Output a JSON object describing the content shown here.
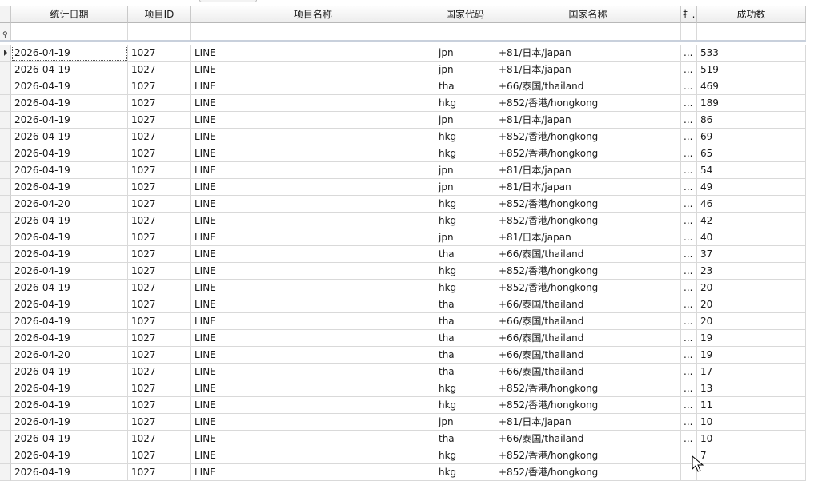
{
  "columns": [
    "统计日期",
    "项目ID",
    "项目名称",
    "国家代码",
    "国家名称",
    "扌.",
    "成功数"
  ],
  "rows": [
    [
      "2026-04-19",
      "1027",
      "LINE",
      "jpn",
      "+81/日本/japan",
      "...",
      "533"
    ],
    [
      "2026-04-19",
      "1027",
      "LINE",
      "jpn",
      "+81/日本/japan",
      "...",
      "519"
    ],
    [
      "2026-04-19",
      "1027",
      "LINE",
      "tha",
      "+66/泰国/thailand",
      "...",
      "469"
    ],
    [
      "2026-04-19",
      "1027",
      "LINE",
      "hkg",
      "+852/香港/hongkong",
      "...",
      "189"
    ],
    [
      "2026-04-19",
      "1027",
      "LINE",
      "jpn",
      "+81/日本/japan",
      "...",
      "86"
    ],
    [
      "2026-04-19",
      "1027",
      "LINE",
      "hkg",
      "+852/香港/hongkong",
      "...",
      "69"
    ],
    [
      "2026-04-19",
      "1027",
      "LINE",
      "hkg",
      "+852/香港/hongkong",
      "...",
      "65"
    ],
    [
      "2026-04-19",
      "1027",
      "LINE",
      "jpn",
      "+81/日本/japan",
      "...",
      "54"
    ],
    [
      "2026-04-19",
      "1027",
      "LINE",
      "jpn",
      "+81/日本/japan",
      "...",
      "49"
    ],
    [
      "2026-04-20",
      "1027",
      "LINE",
      "hkg",
      "+852/香港/hongkong",
      "...",
      "46"
    ],
    [
      "2026-04-19",
      "1027",
      "LINE",
      "hkg",
      "+852/香港/hongkong",
      "...",
      "42"
    ],
    [
      "2026-04-19",
      "1027",
      "LINE",
      "jpn",
      "+81/日本/japan",
      "...",
      "40"
    ],
    [
      "2026-04-19",
      "1027",
      "LINE",
      "tha",
      "+66/泰国/thailand",
      "...",
      "37"
    ],
    [
      "2026-04-19",
      "1027",
      "LINE",
      "hkg",
      "+852/香港/hongkong",
      "...",
      "23"
    ],
    [
      "2026-04-19",
      "1027",
      "LINE",
      "hkg",
      "+852/香港/hongkong",
      "...",
      "20"
    ],
    [
      "2026-04-19",
      "1027",
      "LINE",
      "tha",
      "+66/泰国/thailand",
      "...",
      "20"
    ],
    [
      "2026-04-19",
      "1027",
      "LINE",
      "tha",
      "+66/泰国/thailand",
      "...",
      "20"
    ],
    [
      "2026-04-19",
      "1027",
      "LINE",
      "tha",
      "+66/泰国/thailand",
      "...",
      "19"
    ],
    [
      "2026-04-20",
      "1027",
      "LINE",
      "tha",
      "+66/泰国/thailand",
      "...",
      "19"
    ],
    [
      "2026-04-19",
      "1027",
      "LINE",
      "tha",
      "+66/泰国/thailand",
      "...",
      "17"
    ],
    [
      "2026-04-19",
      "1027",
      "LINE",
      "hkg",
      "+852/香港/hongkong",
      "...",
      "13"
    ],
    [
      "2026-04-19",
      "1027",
      "LINE",
      "hkg",
      "+852/香港/hongkong",
      "...",
      "11"
    ],
    [
      "2026-04-19",
      "1027",
      "LINE",
      "jpn",
      "+81/日本/japan",
      "...",
      "10"
    ],
    [
      "2026-04-19",
      "1027",
      "LINE",
      "tha",
      "+66/泰国/thailand",
      "...",
      "10"
    ],
    [
      "2026-04-19",
      "1027",
      "LINE",
      "hkg",
      "+852/香港/hongkong",
      "",
      "7"
    ],
    [
      "2026-04-19",
      "1027",
      "LINE",
      "hkg",
      "+852/香港/hongkong",
      "",
      ""
    ]
  ],
  "icons": {
    "filter_row": "filter-pin-icon",
    "current_row": "row-indicator-icon",
    "cursor": "mouse-pointer-icon"
  }
}
